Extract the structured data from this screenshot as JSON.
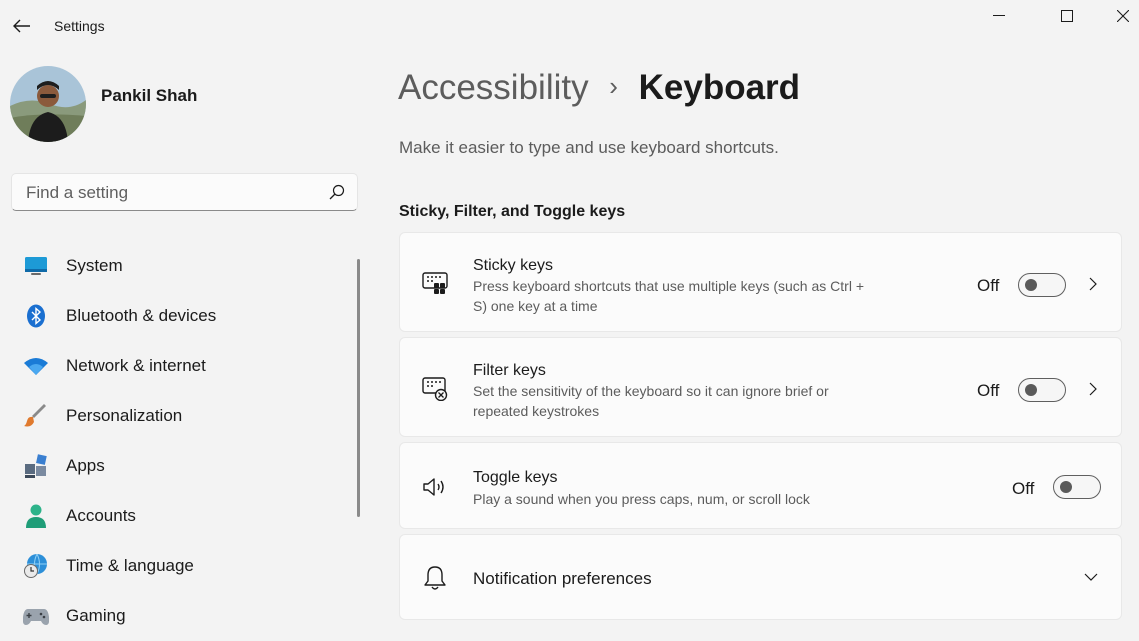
{
  "window": {
    "title": "Settings"
  },
  "profile": {
    "name": "Pankil Shah"
  },
  "search": {
    "placeholder": "Find a setting"
  },
  "nav": {
    "items": [
      {
        "label": "System",
        "icon": "system-icon"
      },
      {
        "label": "Bluetooth & devices",
        "icon": "bluetooth-icon"
      },
      {
        "label": "Network & internet",
        "icon": "wifi-icon"
      },
      {
        "label": "Personalization",
        "icon": "brush-icon"
      },
      {
        "label": "Apps",
        "icon": "apps-icon"
      },
      {
        "label": "Accounts",
        "icon": "person-icon"
      },
      {
        "label": "Time & language",
        "icon": "globe-clock-icon"
      },
      {
        "label": "Gaming",
        "icon": "gamepad-icon"
      }
    ]
  },
  "breadcrumb": {
    "parent": "Accessibility",
    "separator": "›",
    "current": "Keyboard"
  },
  "page": {
    "subtitle": "Make it easier to type and use keyboard shortcuts.",
    "section_title": "Sticky, Filter, and Toggle keys"
  },
  "settings": [
    {
      "title": "Sticky keys",
      "description": "Press keyboard shortcuts that use multiple keys (such as Ctrl + S) one key at a time",
      "state": "Off",
      "icon": "sticky-keys-icon"
    },
    {
      "title": "Filter keys",
      "description": "Set the sensitivity of the keyboard so it can ignore brief or repeated keystrokes",
      "state": "Off",
      "icon": "filter-keys-icon"
    },
    {
      "title": "Toggle keys",
      "description": "Play a sound when you press caps, num, or scroll lock",
      "state": "Off",
      "icon": "speaker-icon"
    },
    {
      "title": "Notification preferences",
      "icon": "bell-icon"
    }
  ],
  "colors": {
    "background": "#f3f3f3",
    "card": "#fbfbfb",
    "accent_blue": "#0078d4"
  }
}
